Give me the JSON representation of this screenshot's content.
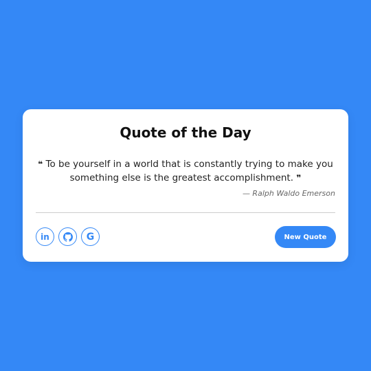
{
  "card": {
    "title": "Quote of the Day",
    "quote_open": "❝",
    "quote_text": " To be yourself in a world that is constantly trying to make you something else is the greatest accomplishment. ",
    "quote_close": "❞",
    "author": "— Ralph Waldo Emerson"
  },
  "socials": [
    {
      "icon": "linkedin-icon",
      "label": "in"
    },
    {
      "icon": "github-icon"
    },
    {
      "icon": "google-icon",
      "label": "G"
    }
  ],
  "actions": {
    "new_quote_label": "New Quote"
  },
  "colors": {
    "background": "#3488f6",
    "accent": "#3488f6",
    "card": "#ffffff"
  }
}
